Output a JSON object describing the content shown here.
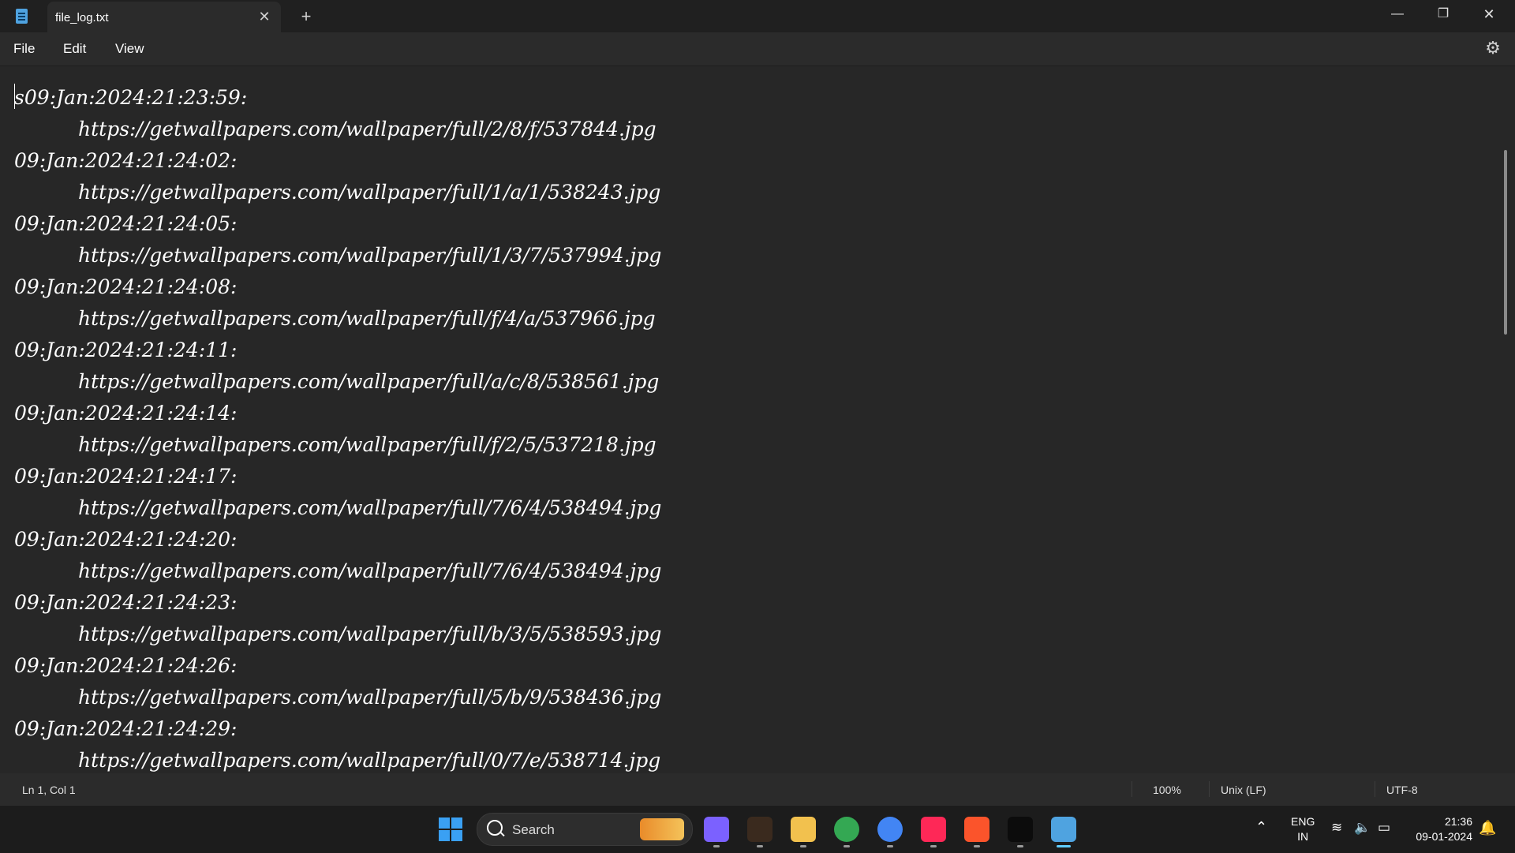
{
  "window": {
    "tab_title": "file_log.txt",
    "close_tab_glyph": "✕",
    "new_tab_glyph": "+",
    "minimize_glyph": "—",
    "maximize_glyph": "❐",
    "close_glyph": "✕"
  },
  "menu": {
    "file": "File",
    "edit": "Edit",
    "view": "View",
    "settings_icon": "gear-icon"
  },
  "editor": {
    "lines": [
      "s09:Jan:2024:21:23:59:",
      "https://getwallpapers.com/wallpaper/full/2/8/f/537844.jpg",
      "09:Jan:2024:21:24:02:",
      "https://getwallpapers.com/wallpaper/full/1/a/1/538243.jpg",
      "09:Jan:2024:21:24:05:",
      "https://getwallpapers.com/wallpaper/full/1/3/7/537994.jpg",
      "09:Jan:2024:21:24:08:",
      "https://getwallpapers.com/wallpaper/full/f/4/a/537966.jpg",
      "09:Jan:2024:21:24:11:",
      "https://getwallpapers.com/wallpaper/full/a/c/8/538561.jpg",
      "09:Jan:2024:21:24:14:",
      "https://getwallpapers.com/wallpaper/full/f/2/5/537218.jpg",
      "09:Jan:2024:21:24:17:",
      "https://getwallpapers.com/wallpaper/full/7/6/4/538494.jpg",
      "09:Jan:2024:21:24:20:",
      "https://getwallpapers.com/wallpaper/full/7/6/4/538494.jpg",
      "09:Jan:2024:21:24:23:",
      "https://getwallpapers.com/wallpaper/full/b/3/5/538593.jpg",
      "09:Jan:2024:21:24:26:",
      "https://getwallpapers.com/wallpaper/full/5/b/9/538436.jpg",
      "09:Jan:2024:21:24:29:",
      "https://getwallpapers.com/wallpaper/full/0/7/e/538714.jpg"
    ]
  },
  "status": {
    "position": "Ln 1, Col 1",
    "zoom": "100%",
    "line_ending": "Unix (LF)",
    "encoding": "UTF-8"
  },
  "taskbar": {
    "search_placeholder": "Search",
    "apps": [
      {
        "name": "copilot-icon",
        "color": "#7b61ff"
      },
      {
        "name": "chess-icon",
        "color": "#3a2a1e"
      },
      {
        "name": "file-explorer-icon",
        "color": "#f2c14e"
      },
      {
        "name": "chrome-icon",
        "color": "#34a853"
      },
      {
        "name": "chrome-profile-icon",
        "color": "#4285f4"
      },
      {
        "name": "intellij-icon",
        "color": "#fe2857"
      },
      {
        "name": "brave-icon",
        "color": "#fb542b"
      },
      {
        "name": "terminal-icon",
        "color": "#0c0c0c"
      },
      {
        "name": "notepad-icon",
        "color": "#4fa3e0"
      }
    ],
    "tray": {
      "lang_top": "ENG",
      "lang_bottom": "IN",
      "time": "21:36",
      "date": "09-01-2024"
    }
  }
}
